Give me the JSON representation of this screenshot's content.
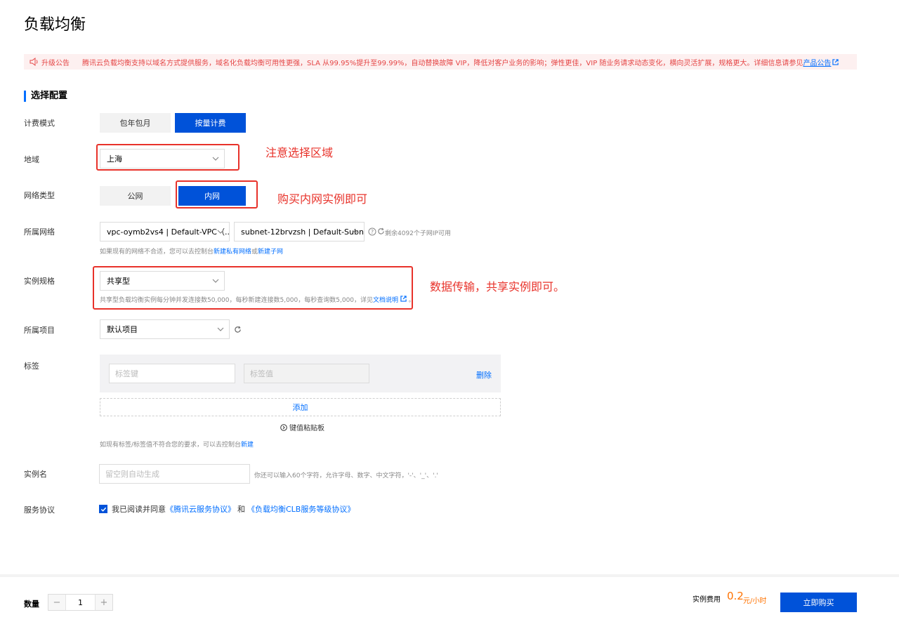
{
  "page": {
    "title": "负载均衡"
  },
  "notice": {
    "tag": "升级公告",
    "text": "腾讯云负载均衡支持以域名方式提供服务，域名化负载均衡可用性更强，SLA 从99.95%提升至99.99%，自动替换故障 VIP，降低对客户业务的影响；弹性更佳，VIP 随业务请求动态变化，横向灵活扩展，规格更大。详细信息请参见",
    "link": "产品公告"
  },
  "section": {
    "title": "选择配置"
  },
  "billing": {
    "label": "计费模式",
    "options": [
      "包年包月",
      "按量计费"
    ],
    "selected": "按量计费"
  },
  "region": {
    "label": "地域",
    "value": "上海"
  },
  "network_type": {
    "label": "网络类型",
    "options": [
      "公网",
      "内网"
    ],
    "selected": "内网"
  },
  "network": {
    "label": "所属网络",
    "vpc": "vpc-oymb2vs4 | Default-VPC（...",
    "subnet": "subnet-12brvzsh | Default-Subn...",
    "remaining": "剩余4092个子网IP可用",
    "hint_prefix": "如果现有的网络不合适，您可以去控制台",
    "hint_link1": "新建私有网络",
    "hint_or": "或",
    "hint_link2": "新建子网"
  },
  "spec": {
    "label": "实例规格",
    "value": "共享型",
    "hint": "共享型负载均衡实例每分钟并发连接数50,000，每秒新建连接数5,000，每秒查询数5,000，详见",
    "hint_link": "文档说明",
    "hint_end": "。"
  },
  "project": {
    "label": "所属项目",
    "value": "默认项目"
  },
  "tags": {
    "label": "标签",
    "key_placeholder": "标签键",
    "value_placeholder": "标签值",
    "delete": "删除",
    "add": "添加",
    "clipboard": "键值粘贴板",
    "hint_prefix": "如现有标签/标签值不符合您的要求，可以去控制台",
    "hint_link": "新建"
  },
  "instance_name": {
    "label": "实例名",
    "placeholder": "留空则自动生成",
    "hint": "你还可以输入60个字符，允许字母、数字、中文字符，'-'、'_'、'.'"
  },
  "agreement": {
    "label": "服务协议",
    "prefix": "我已阅读并同意",
    "link1": "《腾讯云服务协议》",
    "and": "和",
    "link2": "《负载均衡CLB服务等级协议》",
    "checked": true
  },
  "annotations": {
    "region": "注意选择区域",
    "network": "购买内网实例即可",
    "spec": "数据传输，共享实例即可。"
  },
  "footer": {
    "quantity_label": "数量",
    "quantity": "1",
    "minus": "−",
    "plus": "+",
    "fee_label": "实例费用",
    "fee_value": "0.2",
    "fee_unit": "元/小时",
    "buy": "立即购买"
  },
  "colors": {
    "primary": "#0052d9",
    "link": "#006eff",
    "annotation": "#e8322a",
    "price": "#ff7200",
    "notice_bg": "#fdf0f0"
  }
}
